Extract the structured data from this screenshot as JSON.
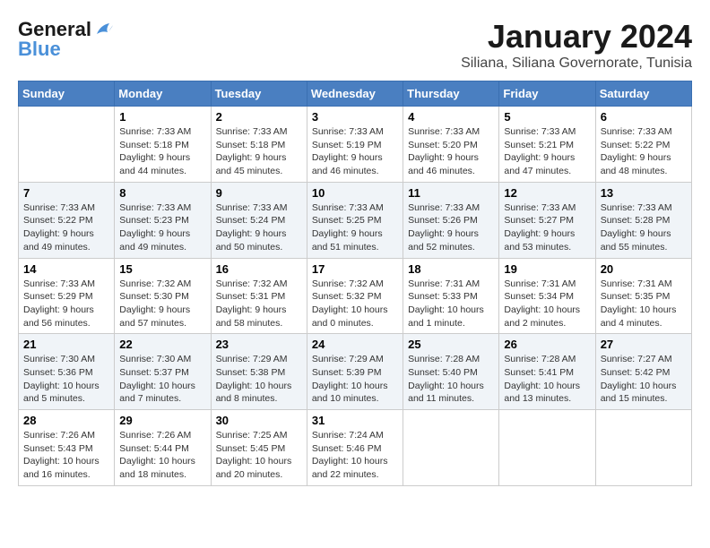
{
  "header": {
    "logo_line1": "General",
    "logo_line2": "Blue",
    "title": "January 2024",
    "subtitle": "Siliana, Siliana Governorate, Tunisia"
  },
  "calendar": {
    "weekdays": [
      "Sunday",
      "Monday",
      "Tuesday",
      "Wednesday",
      "Thursday",
      "Friday",
      "Saturday"
    ],
    "weeks": [
      [
        {
          "num": "",
          "sunrise": "",
          "sunset": "",
          "daylight": ""
        },
        {
          "num": "1",
          "sunrise": "Sunrise: 7:33 AM",
          "sunset": "Sunset: 5:18 PM",
          "daylight": "Daylight: 9 hours and 44 minutes."
        },
        {
          "num": "2",
          "sunrise": "Sunrise: 7:33 AM",
          "sunset": "Sunset: 5:18 PM",
          "daylight": "Daylight: 9 hours and 45 minutes."
        },
        {
          "num": "3",
          "sunrise": "Sunrise: 7:33 AM",
          "sunset": "Sunset: 5:19 PM",
          "daylight": "Daylight: 9 hours and 46 minutes."
        },
        {
          "num": "4",
          "sunrise": "Sunrise: 7:33 AM",
          "sunset": "Sunset: 5:20 PM",
          "daylight": "Daylight: 9 hours and 46 minutes."
        },
        {
          "num": "5",
          "sunrise": "Sunrise: 7:33 AM",
          "sunset": "Sunset: 5:21 PM",
          "daylight": "Daylight: 9 hours and 47 minutes."
        },
        {
          "num": "6",
          "sunrise": "Sunrise: 7:33 AM",
          "sunset": "Sunset: 5:22 PM",
          "daylight": "Daylight: 9 hours and 48 minutes."
        }
      ],
      [
        {
          "num": "7",
          "sunrise": "Sunrise: 7:33 AM",
          "sunset": "Sunset: 5:22 PM",
          "daylight": "Daylight: 9 hours and 49 minutes."
        },
        {
          "num": "8",
          "sunrise": "Sunrise: 7:33 AM",
          "sunset": "Sunset: 5:23 PM",
          "daylight": "Daylight: 9 hours and 49 minutes."
        },
        {
          "num": "9",
          "sunrise": "Sunrise: 7:33 AM",
          "sunset": "Sunset: 5:24 PM",
          "daylight": "Daylight: 9 hours and 50 minutes."
        },
        {
          "num": "10",
          "sunrise": "Sunrise: 7:33 AM",
          "sunset": "Sunset: 5:25 PM",
          "daylight": "Daylight: 9 hours and 51 minutes."
        },
        {
          "num": "11",
          "sunrise": "Sunrise: 7:33 AM",
          "sunset": "Sunset: 5:26 PM",
          "daylight": "Daylight: 9 hours and 52 minutes."
        },
        {
          "num": "12",
          "sunrise": "Sunrise: 7:33 AM",
          "sunset": "Sunset: 5:27 PM",
          "daylight": "Daylight: 9 hours and 53 minutes."
        },
        {
          "num": "13",
          "sunrise": "Sunrise: 7:33 AM",
          "sunset": "Sunset: 5:28 PM",
          "daylight": "Daylight: 9 hours and 55 minutes."
        }
      ],
      [
        {
          "num": "14",
          "sunrise": "Sunrise: 7:33 AM",
          "sunset": "Sunset: 5:29 PM",
          "daylight": "Daylight: 9 hours and 56 minutes."
        },
        {
          "num": "15",
          "sunrise": "Sunrise: 7:32 AM",
          "sunset": "Sunset: 5:30 PM",
          "daylight": "Daylight: 9 hours and 57 minutes."
        },
        {
          "num": "16",
          "sunrise": "Sunrise: 7:32 AM",
          "sunset": "Sunset: 5:31 PM",
          "daylight": "Daylight: 9 hours and 58 minutes."
        },
        {
          "num": "17",
          "sunrise": "Sunrise: 7:32 AM",
          "sunset": "Sunset: 5:32 PM",
          "daylight": "Daylight: 10 hours and 0 minutes."
        },
        {
          "num": "18",
          "sunrise": "Sunrise: 7:31 AM",
          "sunset": "Sunset: 5:33 PM",
          "daylight": "Daylight: 10 hours and 1 minute."
        },
        {
          "num": "19",
          "sunrise": "Sunrise: 7:31 AM",
          "sunset": "Sunset: 5:34 PM",
          "daylight": "Daylight: 10 hours and 2 minutes."
        },
        {
          "num": "20",
          "sunrise": "Sunrise: 7:31 AM",
          "sunset": "Sunset: 5:35 PM",
          "daylight": "Daylight: 10 hours and 4 minutes."
        }
      ],
      [
        {
          "num": "21",
          "sunrise": "Sunrise: 7:30 AM",
          "sunset": "Sunset: 5:36 PM",
          "daylight": "Daylight: 10 hours and 5 minutes."
        },
        {
          "num": "22",
          "sunrise": "Sunrise: 7:30 AM",
          "sunset": "Sunset: 5:37 PM",
          "daylight": "Daylight: 10 hours and 7 minutes."
        },
        {
          "num": "23",
          "sunrise": "Sunrise: 7:29 AM",
          "sunset": "Sunset: 5:38 PM",
          "daylight": "Daylight: 10 hours and 8 minutes."
        },
        {
          "num": "24",
          "sunrise": "Sunrise: 7:29 AM",
          "sunset": "Sunset: 5:39 PM",
          "daylight": "Daylight: 10 hours and 10 minutes."
        },
        {
          "num": "25",
          "sunrise": "Sunrise: 7:28 AM",
          "sunset": "Sunset: 5:40 PM",
          "daylight": "Daylight: 10 hours and 11 minutes."
        },
        {
          "num": "26",
          "sunrise": "Sunrise: 7:28 AM",
          "sunset": "Sunset: 5:41 PM",
          "daylight": "Daylight: 10 hours and 13 minutes."
        },
        {
          "num": "27",
          "sunrise": "Sunrise: 7:27 AM",
          "sunset": "Sunset: 5:42 PM",
          "daylight": "Daylight: 10 hours and 15 minutes."
        }
      ],
      [
        {
          "num": "28",
          "sunrise": "Sunrise: 7:26 AM",
          "sunset": "Sunset: 5:43 PM",
          "daylight": "Daylight: 10 hours and 16 minutes."
        },
        {
          "num": "29",
          "sunrise": "Sunrise: 7:26 AM",
          "sunset": "Sunset: 5:44 PM",
          "daylight": "Daylight: 10 hours and 18 minutes."
        },
        {
          "num": "30",
          "sunrise": "Sunrise: 7:25 AM",
          "sunset": "Sunset: 5:45 PM",
          "daylight": "Daylight: 10 hours and 20 minutes."
        },
        {
          "num": "31",
          "sunrise": "Sunrise: 7:24 AM",
          "sunset": "Sunset: 5:46 PM",
          "daylight": "Daylight: 10 hours and 22 minutes."
        },
        {
          "num": "",
          "sunrise": "",
          "sunset": "",
          "daylight": ""
        },
        {
          "num": "",
          "sunrise": "",
          "sunset": "",
          "daylight": ""
        },
        {
          "num": "",
          "sunrise": "",
          "sunset": "",
          "daylight": ""
        }
      ]
    ]
  }
}
